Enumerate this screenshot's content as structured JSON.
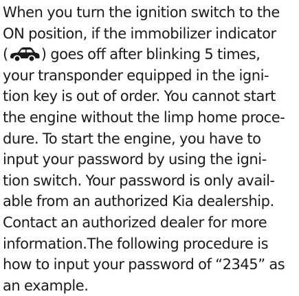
{
  "icon": {
    "name": "immobilizer-car-icon",
    "color": "#1a1a1a"
  },
  "text": {
    "line1": "When you turn the ignition switch to the",
    "line2_before_icon": "ON position, if the immobilizer indicator",
    "line3_open": "(",
    "line3_after_icon": ") goes off after blinking 5 times,",
    "line4": "your transponder equipped in the igni-",
    "line5": "tion key is out of order. You cannot start",
    "line6": "the engine without the limp home proce-",
    "line7": "dure. To start the engine, you have to",
    "line8": "input your password by using the igni-",
    "line9": "tion switch. Your password is only avail-",
    "line10": "able from an authorized Kia dealership.",
    "line11": "Contact an authorized dealer for more",
    "line12": "information.The following procedure is",
    "line13": "how to input your password of “2345” as",
    "line14": "an example."
  }
}
